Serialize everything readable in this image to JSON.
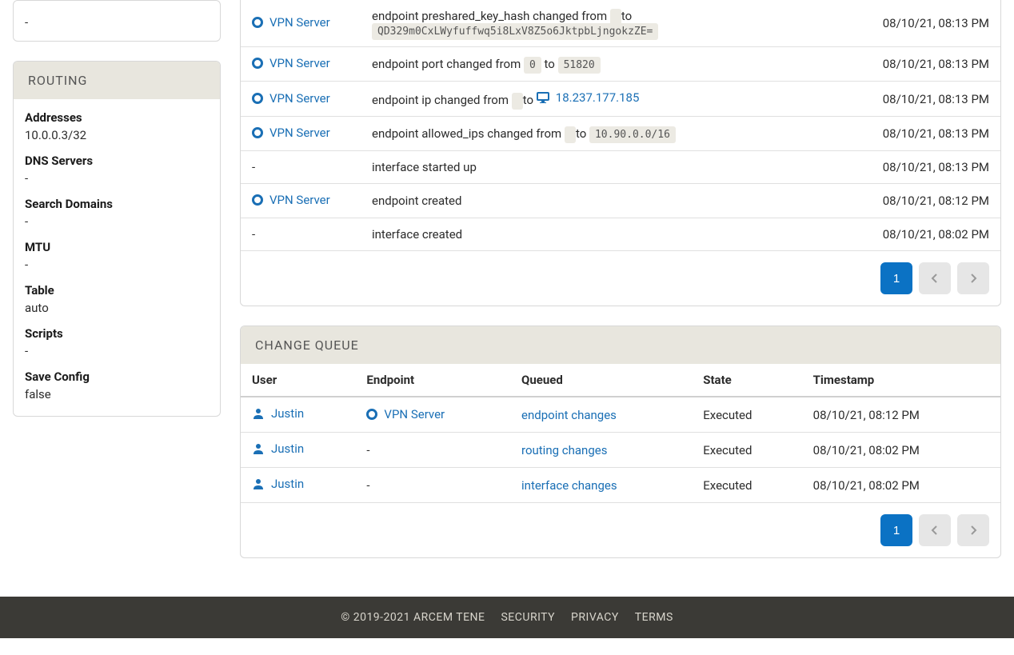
{
  "sidebar": {
    "top_value": "-",
    "routing": {
      "title": "ROUTING",
      "fields": [
        {
          "label": "Addresses",
          "value": "10.0.0.3/32"
        },
        {
          "label": "DNS Servers",
          "value": "-"
        },
        {
          "label": "Search Domains",
          "value": "-"
        },
        {
          "label": "MTU",
          "value": "-"
        },
        {
          "label": "Table",
          "value": "auto"
        },
        {
          "label": "Scripts",
          "value": "-"
        },
        {
          "label": "Save Config",
          "value": "false"
        }
      ]
    }
  },
  "log": {
    "rows": [
      {
        "endpoint": "VPN Server",
        "prefix": "endpoint preshared_key_hash changed from ",
        "from": "",
        "mid": " to ",
        "to": "QD329m0CxLWyfuffwq5i8LxV8Z5o6JktpbLjngokzZE=",
        "timestamp": "08/10/21, 08:13 PM",
        "style": "code_both"
      },
      {
        "endpoint": "VPN Server",
        "prefix": "endpoint port changed from ",
        "from": "0",
        "mid": " to ",
        "to": "51820",
        "timestamp": "08/10/21, 08:13 PM",
        "style": "code_both"
      },
      {
        "endpoint": "VPN Server",
        "prefix": "endpoint ip changed from ",
        "from": "",
        "mid": " to ",
        "to": "18.237.177.185",
        "timestamp": "08/10/21, 08:13 PM",
        "style": "ip_link"
      },
      {
        "endpoint": "VPN Server",
        "prefix": "endpoint allowed_ips changed from ",
        "from": "",
        "mid": " to ",
        "to": "10.90.0.0/16",
        "timestamp": "08/10/21, 08:13 PM",
        "style": "code_both"
      },
      {
        "endpoint": "-",
        "prefix": "interface started up",
        "timestamp": "08/10/21, 08:13 PM",
        "style": "plain"
      },
      {
        "endpoint": "VPN Server",
        "prefix": "endpoint created",
        "timestamp": "08/10/21, 08:12 PM",
        "style": "plain"
      },
      {
        "endpoint": "-",
        "prefix": "interface created",
        "timestamp": "08/10/21, 08:02 PM",
        "style": "plain"
      }
    ],
    "page": "1"
  },
  "queue": {
    "title": "CHANGE QUEUE",
    "headers": {
      "user": "User",
      "endpoint": "Endpoint",
      "queued": "Queued",
      "state": "State",
      "timestamp": "Timestamp"
    },
    "rows": [
      {
        "user": "Justin",
        "endpoint": "VPN Server",
        "queued": "endpoint changes",
        "state": "Executed",
        "timestamp": "08/10/21, 08:12 PM"
      },
      {
        "user": "Justin",
        "endpoint": "-",
        "queued": "routing changes",
        "state": "Executed",
        "timestamp": "08/10/21, 08:02 PM"
      },
      {
        "user": "Justin",
        "endpoint": "-",
        "queued": "interface changes",
        "state": "Executed",
        "timestamp": "08/10/21, 08:02 PM"
      }
    ],
    "page": "1"
  },
  "footer": {
    "copyright": "© 2019-2021 ARCEM TENE",
    "links": [
      "SECURITY",
      "PRIVACY",
      "TERMS"
    ]
  }
}
